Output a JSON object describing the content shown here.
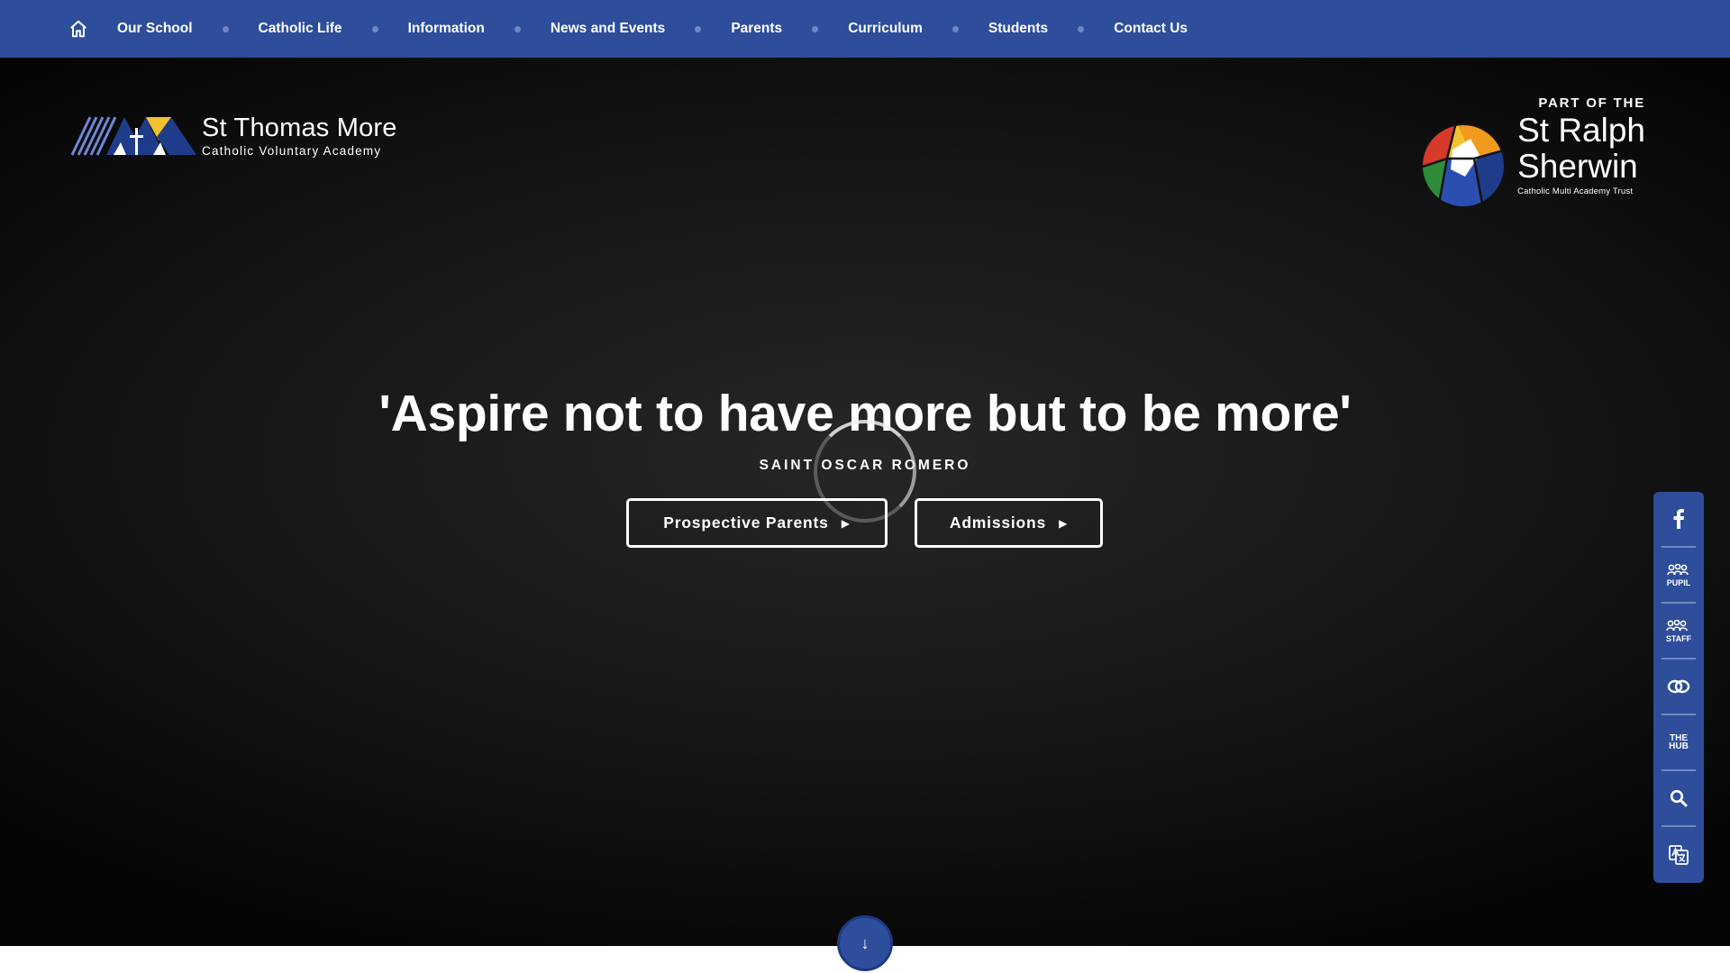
{
  "nav": {
    "home_icon": "home-icon",
    "items": [
      "Our School",
      "Catholic Life",
      "Information",
      "News and Events",
      "Parents",
      "Curriculum",
      "Students",
      "Contact Us"
    ]
  },
  "school": {
    "name": "St Thomas More",
    "subtitle": "Catholic Voluntary Academy"
  },
  "trust": {
    "part_of": "PART OF THE",
    "name_line1": "St Ralph",
    "name_line2": "Sherwin",
    "subtitle": "Catholic Multi Academy Trust"
  },
  "hero": {
    "quote": "'Aspire not to have more but to be more'",
    "author": "SAINT OSCAR ROMERO",
    "buttons": {
      "prospective": "Prospective Parents",
      "admissions": "Admissions"
    }
  },
  "quicklinks": {
    "pupil": "PUPIL",
    "staff": "STAFF",
    "hub_line1": "THE",
    "hub_line2": "HUB"
  },
  "colors": {
    "nav_blue": "#2e4e9c",
    "hero_dark": "#161616",
    "gold": "#f2c230"
  }
}
